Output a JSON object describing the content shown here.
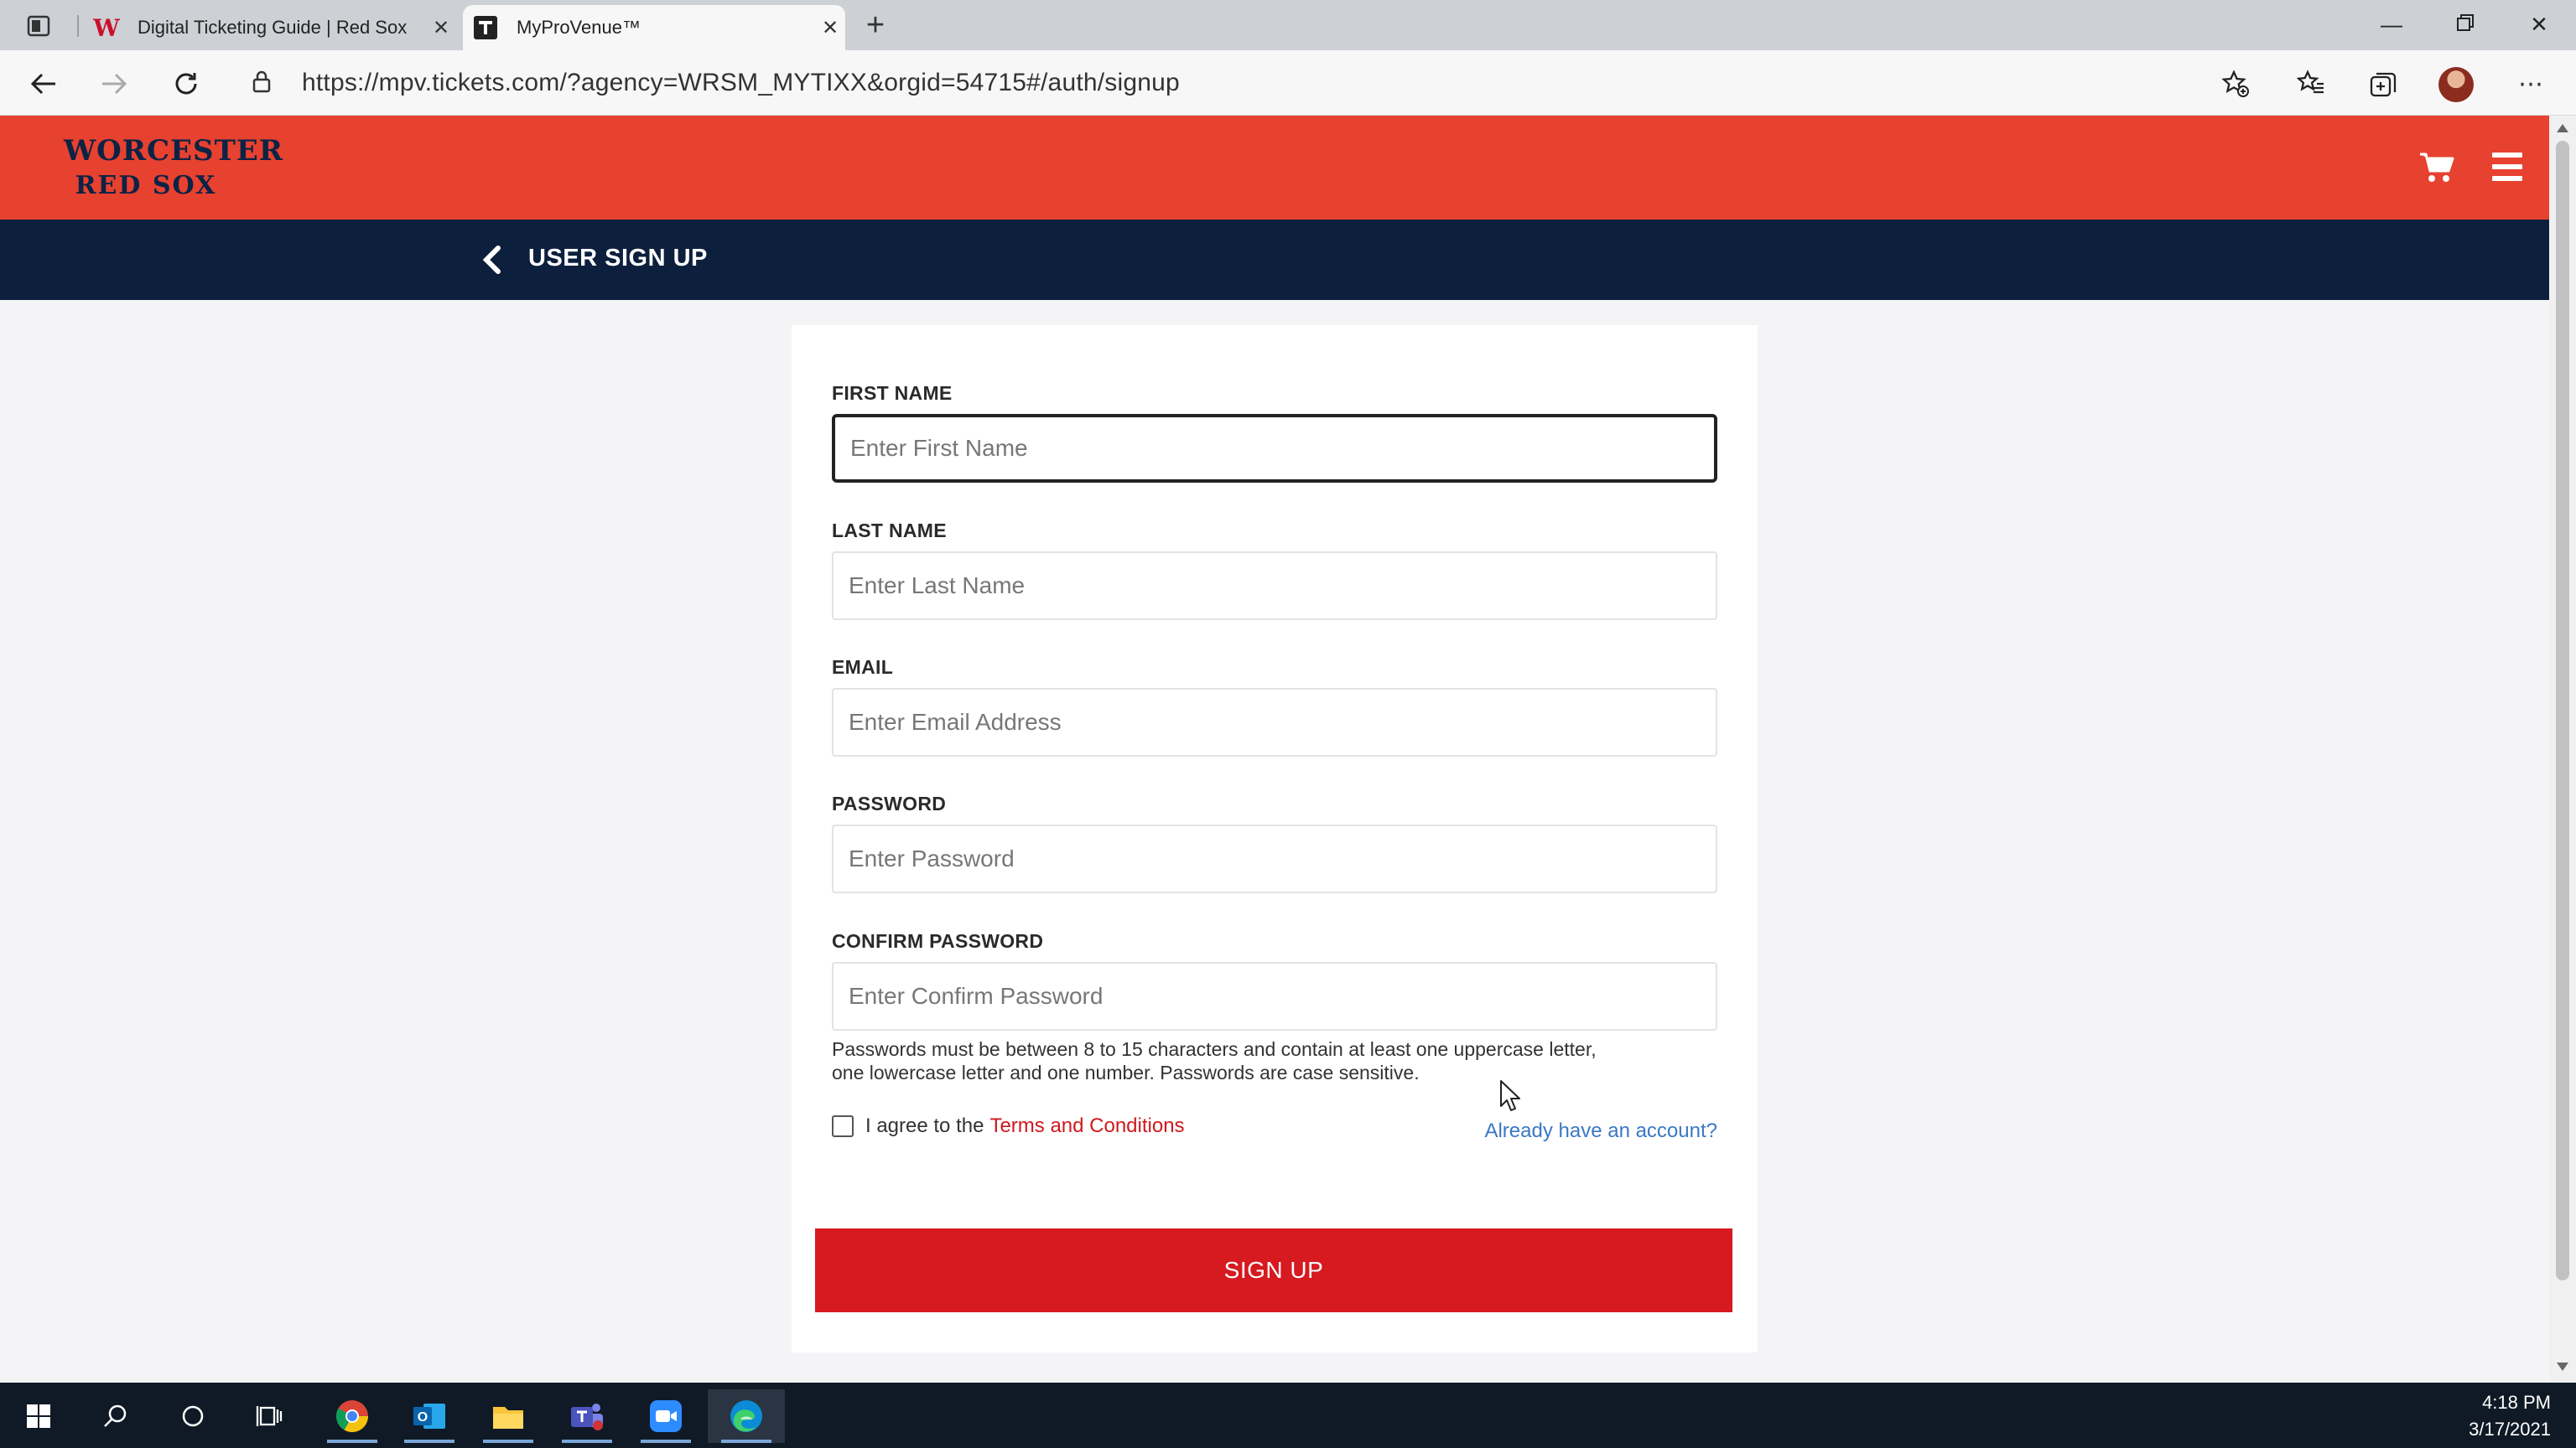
{
  "browser": {
    "tabs": [
      {
        "title": "Digital Ticketing Guide | Red Sox",
        "active": false
      },
      {
        "title": "MyProVenue™",
        "active": true
      }
    ],
    "url": "https://mpv.tickets.com/?agency=WRSM_MYTIXX&orgid=54715#/auth/signup"
  },
  "site": {
    "logo_line1": "WORCESTER",
    "logo_line2": "RED SOX",
    "brand_color": "#e7412f",
    "nav_color": "#0c1f3d",
    "page_title": "USER SIGN UP"
  },
  "form": {
    "first_name": {
      "label": "FIRST NAME",
      "placeholder": "Enter First Name",
      "value": ""
    },
    "last_name": {
      "label": "LAST NAME",
      "placeholder": "Enter Last Name",
      "value": ""
    },
    "email": {
      "label": "EMAIL",
      "placeholder": "Enter Email Address",
      "value": ""
    },
    "password": {
      "label": "PASSWORD",
      "placeholder": "Enter Password",
      "value": ""
    },
    "confirm_password": {
      "label": "CONFIRM PASSWORD",
      "placeholder": "Enter Confirm Password",
      "value": ""
    },
    "password_help_line1": "Passwords must be between 8 to 15 characters and contain at least one uppercase letter,",
    "password_help_line2": "one lowercase letter and one number. Passwords are case sensitive.",
    "agree_text": "I agree to the",
    "terms_link": "Terms and Conditions",
    "agree_checked": false,
    "already_link": "Already have an account?",
    "submit_label": "SIGN UP",
    "submit_color": "#d71920"
  },
  "taskbar": {
    "apps": [
      "windows-start",
      "search",
      "cortana",
      "task-view",
      "chrome",
      "outlook",
      "file-explorer",
      "teams",
      "zoom",
      "edge"
    ],
    "active_app": "edge",
    "time": "4:18 PM",
    "date": "3/17/2021"
  }
}
